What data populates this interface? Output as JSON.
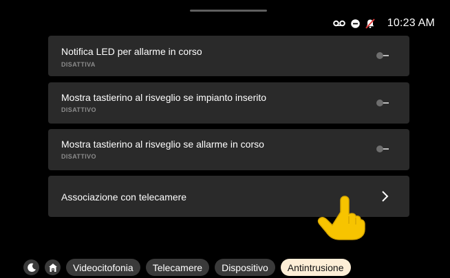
{
  "status_bar": {
    "time": "10:23 AM",
    "icons": [
      "voicemail-icon",
      "do-not-disturb-icon",
      "notifications-off-icon"
    ]
  },
  "settings": [
    {
      "title": "Notifica LED per allarme in corso",
      "subtitle": "DISATTIVA",
      "control": "toggle",
      "enabled": false
    },
    {
      "title": "Mostra tastierino al risveglio se impianto inserito",
      "subtitle": "DISATTIVO",
      "control": "toggle",
      "enabled": false
    },
    {
      "title": "Mostra tastierino al risveglio se allarme in corso",
      "subtitle": "DISATTIVO",
      "control": "toggle",
      "enabled": false
    },
    {
      "title": "Associazione con telecamere",
      "control": "chevron-right-icon"
    }
  ],
  "bottom_nav": {
    "icons": [
      "moon-icon",
      "home-icon"
    ],
    "tabs": [
      {
        "label": "Videocitofonia",
        "active": false
      },
      {
        "label": "Telecamere",
        "active": false
      },
      {
        "label": "Dispositivo",
        "active": false
      },
      {
        "label": "Antintrusione",
        "active": true
      }
    ]
  },
  "colors": {
    "background": "#000000",
    "card": "#2a2a2a",
    "tab": "#3a3a3a",
    "active_tab": "#fdeed6",
    "subtitle": "#8c8c8c",
    "hand": "#f7c400"
  }
}
